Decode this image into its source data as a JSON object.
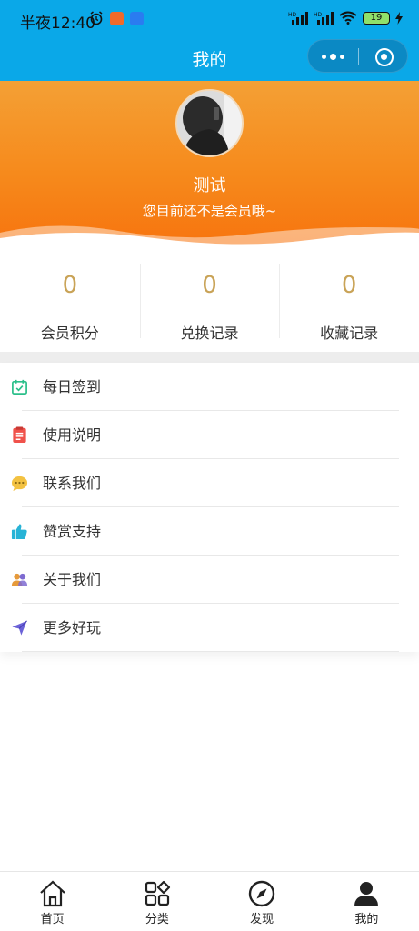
{
  "status_bar": {
    "time": "半夜12:40",
    "battery": "19"
  },
  "nav": {
    "title": "我的"
  },
  "profile": {
    "username": "测试",
    "membership_note": "您目前还不是会员哦~"
  },
  "stats": [
    {
      "value": "0",
      "label": "会员积分"
    },
    {
      "value": "0",
      "label": "兑换记录"
    },
    {
      "value": "0",
      "label": "收藏记录"
    }
  ],
  "menu": [
    {
      "label": "每日签到",
      "icon": "calendar-check-icon",
      "color": "#2bbf8a"
    },
    {
      "label": "使用说明",
      "icon": "clipboard-icon",
      "color": "#f0524b"
    },
    {
      "label": "联系我们",
      "icon": "chat-bubble-icon",
      "color": "#f3c242"
    },
    {
      "label": "赞赏支持",
      "icon": "thumbs-up-icon",
      "color": "#28b3d6"
    },
    {
      "label": "关于我们",
      "icon": "users-icon",
      "color": "#e69a3a"
    },
    {
      "label": "更多好玩",
      "icon": "paper-plane-icon",
      "color": "#6b62d8"
    }
  ],
  "tabbar": [
    {
      "label": "首页",
      "icon": "home-icon"
    },
    {
      "label": "分类",
      "icon": "grid-icon"
    },
    {
      "label": "发现",
      "icon": "compass-icon"
    },
    {
      "label": "我的",
      "icon": "user-icon",
      "active": true
    }
  ],
  "colors": {
    "nav_bg": "#0aa8e8",
    "banner_top": "#f4a035",
    "banner_bottom": "#f7730e",
    "stat_number": "#c9a357"
  }
}
